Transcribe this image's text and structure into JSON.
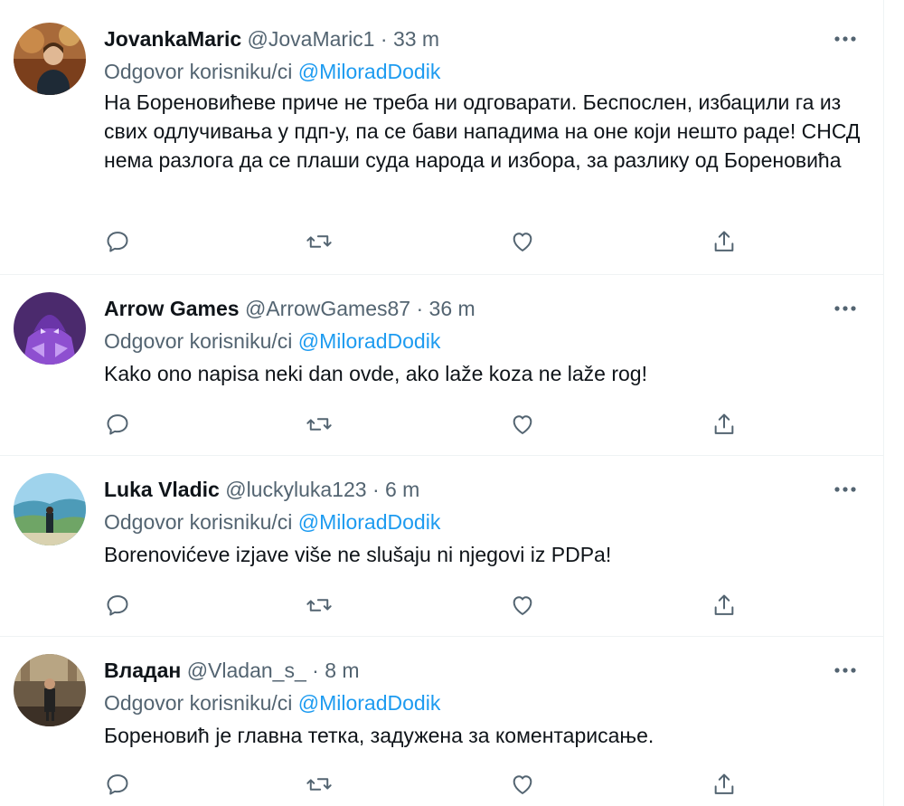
{
  "reply_prefix": "Odgovor korisniku/ci",
  "tweets": [
    {
      "name": "JovankaMaric",
      "handle": "@JovaMaric1",
      "dot": "·",
      "time": "33 m",
      "mention": "@MiloradDodik",
      "text": "На Бореновићеве приче не треба ни одговарати. Беспослен, избацили га из свих одлучивања у пдп-у, па се бави нападима на оне који нешто раде! СНСД нема разлога да се плаши суда народа и избора, за разлику од Бореновића"
    },
    {
      "name": "Arrow Games",
      "handle": "@ArrowGames87",
      "dot": "·",
      "time": "36 m",
      "mention": "@MiloradDodik",
      "text": "Kako ono napisa neki dan ovde, ako laže koza ne laže rog!"
    },
    {
      "name": "Luka Vladic",
      "handle": "@luckyluka123",
      "dot": "·",
      "time": "6 m",
      "mention": "@MiloradDodik",
      "text": "Borenovićeve izjave više ne slušaju ni njegovi iz PDPa!"
    },
    {
      "name": "Владан",
      "handle": "@Vladan_s_",
      "dot": "·",
      "time": "8 m",
      "mention": "@MiloradDodik",
      "text": "Бореновић је главна тетка, задужена за коментарисање."
    }
  ],
  "colors": {
    "mention": "#1d9bf0",
    "muted": "#536471",
    "text": "#0f1419",
    "divider": "#eff3f4"
  },
  "icons": [
    "more-icon",
    "reply-icon",
    "retweet-icon",
    "like-icon",
    "share-icon"
  ]
}
